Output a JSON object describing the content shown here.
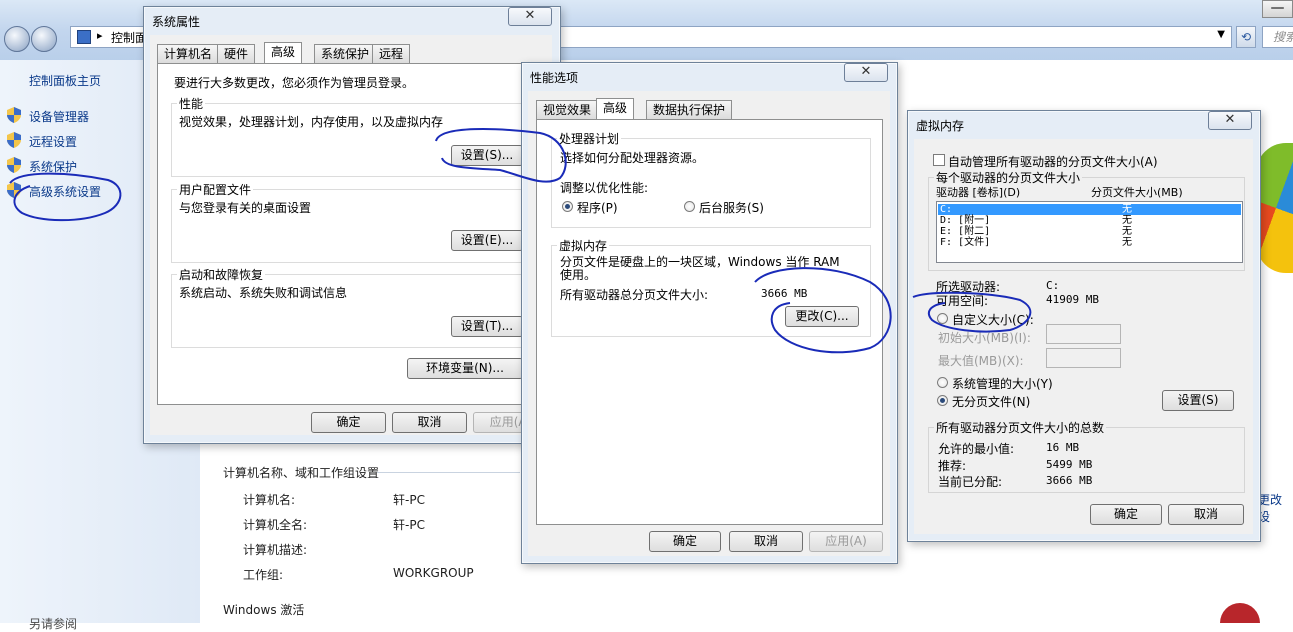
{
  "control_panel": {
    "address_crumb": "控制面",
    "search_placeholder": "搜索",
    "sidebar": {
      "home": "控制面板主页",
      "items": [
        "设备管理器",
        "远程设置",
        "系统保护",
        "高级系统设置"
      ],
      "bottom": "另请参阅"
    },
    "section_computer": "计算机名称、域和工作组设置",
    "rows": [
      {
        "label": "计算机名:",
        "value": "轩-PC"
      },
      {
        "label": "计算机全名:",
        "value": "轩-PC"
      },
      {
        "label": "计算机描述:",
        "value": ""
      },
      {
        "label": "工作组:",
        "value": "WORKGROUP"
      }
    ],
    "section_activation": "Windows 激活",
    "right_link": "更改设"
  },
  "system_properties": {
    "title": "系统属性",
    "close": "✕",
    "tabs": [
      "计算机名",
      "硬件",
      "高级",
      "系统保护",
      "远程"
    ],
    "admin_note": "要进行大多数更改，您必须作为管理员登录。",
    "performance": {
      "label": "性能",
      "desc": "视觉效果，处理器计划，内存使用，以及虚拟内存",
      "button": "设置(S)..."
    },
    "profiles": {
      "label": "用户配置文件",
      "desc": "与您登录有关的桌面设置",
      "button": "设置(E)..."
    },
    "startup": {
      "label": "启动和故障恢复",
      "desc": "系统启动、系统失败和调试信息",
      "button": "设置(T)..."
    },
    "env_button": "环境变量(N)...",
    "ok": "确定",
    "cancel": "取消",
    "apply": "应用(A)"
  },
  "performance_options": {
    "title": "性能选项",
    "close": "✕",
    "tabs": [
      "视觉效果",
      "高级",
      "数据执行保护"
    ],
    "cpu": {
      "label": "处理器计划",
      "desc": "选择如何分配处理器资源。",
      "adjust": "调整以优化性能:",
      "opt_programs": "程序(P)",
      "opt_services": "后台服务(S)"
    },
    "vm": {
      "label": "虚拟内存",
      "desc": "分页文件是硬盘上的一块区域，Windows 当作 RAM 使用。",
      "total_label": "所有驱动器总分页文件大小:",
      "total_value": "3666 MB",
      "change_button": "更改(C)..."
    },
    "ok": "确定",
    "cancel": "取消",
    "apply": "应用(A)"
  },
  "virtual_memory": {
    "title": "虚拟内存",
    "close": "✕",
    "auto_manage": "自动管理所有驱动器的分页文件大小(A)",
    "per_drive_label": "每个驱动器的分页文件大小",
    "col_drive": "驱动器 [卷标](D)",
    "col_size": "分页文件大小(MB)",
    "drives": [
      {
        "drive": "C:",
        "size": "无"
      },
      {
        "drive": "D:    [附一]",
        "size": "无"
      },
      {
        "drive": "E:    [附二]",
        "size": "无"
      },
      {
        "drive": "F:    [文件]",
        "size": "无"
      }
    ],
    "selected_drive_label": "所选驱动器:",
    "selected_drive_value": "C:",
    "free_space_label": "可用空间:",
    "free_space_value": "41909 MB",
    "custom_size": "自定义大小(C):",
    "initial_size": "初始大小(MB)(I):",
    "max_size": "最大值(MB)(X):",
    "system_managed": "系统管理的大小(Y)",
    "no_paging": "无分页文件(N)",
    "set_button": "设置(S)",
    "totals_label": "所有驱动器分页文件大小的总数",
    "min_label": "允许的最小值:",
    "min_value": "16 MB",
    "rec_label": "推荐:",
    "rec_value": "5499 MB",
    "cur_label": "当前已分配:",
    "cur_value": "3666 MB",
    "ok": "确定",
    "cancel": "取消"
  },
  "colors": {
    "ink": "#1a2bb8",
    "selection": "#3399ff",
    "link": "#0b3a8a"
  }
}
